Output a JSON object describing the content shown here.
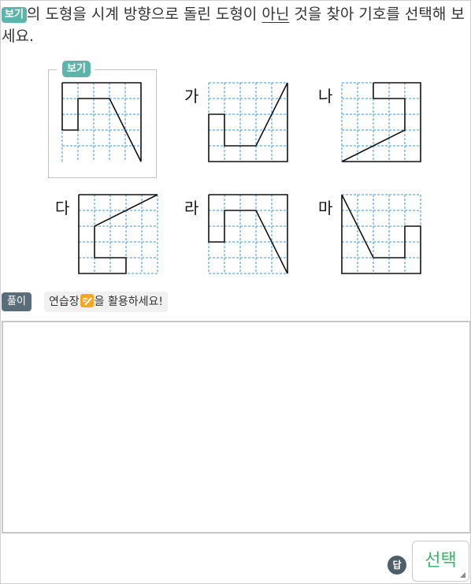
{
  "question": {
    "badge": "보기",
    "text_before": "의 도형을 시계 방향으로 돌린 도형이 ",
    "underlined": "아닌",
    "text_after": " 것을 찾아 기호를 선택해 보세요."
  },
  "reference": {
    "tag": "보기"
  },
  "options": [
    {
      "label": "가"
    },
    {
      "label": "나"
    },
    {
      "label": "다"
    },
    {
      "label": "라"
    },
    {
      "label": "마"
    }
  ],
  "solve": {
    "badge": "풀이",
    "hint_before": "연습장",
    "hint_after": "을 활용하세요!"
  },
  "answer": {
    "badge": "답",
    "select_label": "선택"
  },
  "colors": {
    "teal_badge": "#5bb5ab",
    "grid_dash": "#3a9ad9",
    "select_text": "#3bb36a",
    "dark_badge": "#5a6e7a"
  }
}
